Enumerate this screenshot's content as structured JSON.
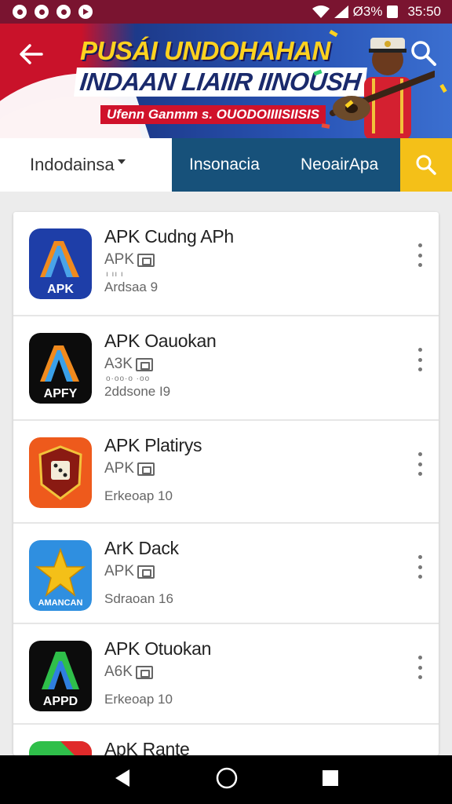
{
  "status_bar": {
    "signal_text": "Ø3%",
    "time": "35:50",
    "left_icons": [
      "notification-icon",
      "hanger-icon",
      "shield-icon",
      "play-icon"
    ],
    "right_icons": [
      "wifi-icon",
      "signal-icon",
      "battery-icon"
    ]
  },
  "banner": {
    "line1": "PUSÁI UNDOHAHAN",
    "line2": "INDAAN LIAIIR IINOUSH",
    "line3": "Ufenn Ganmm s. OUODOIIIISIISIS",
    "colors": {
      "red": "#c9122a",
      "blue": "#1d3a8a",
      "yellow": "#ffd21f"
    }
  },
  "tabs": {
    "country_select": "Indodainsa",
    "tab1": "Insonacia",
    "tab2": "NeoairApa"
  },
  "apps": [
    {
      "name": "APK Cudng APh",
      "sub": "APK",
      "dots": "ı  ıı  ı",
      "version": "Ardsaa 9",
      "icon_label": "APK",
      "icon": "apk-a-icon"
    },
    {
      "name": "APK Oauokan",
      "sub": "A3K",
      "dots": "o·oo·o ·oo",
      "version": "2ddsone I9",
      "icon_label": "APFY",
      "icon": "apk-a-dark-icon"
    },
    {
      "name": "APK Platirys",
      "sub": "APK",
      "dots": "",
      "version": "Erkeoap 10",
      "icon_label": "",
      "icon": "shield-dice-icon"
    },
    {
      "name": "ArK Dack",
      "sub": "APK",
      "dots": "",
      "version": "Sdraoan 16",
      "icon_label": "AMANCAN",
      "icon": "star-icon"
    },
    {
      "name": "APK Otuokan",
      "sub": "A6K",
      "dots": "",
      "version": "Erkeoap 10",
      "icon_label": "APPD",
      "icon": "apk-green-a-icon"
    },
    {
      "name": "ApK Rante",
      "sub": "",
      "dots": "",
      "version": "",
      "icon_label": "",
      "icon": "flag-icon"
    }
  ],
  "navbar": {
    "icons": [
      "back-icon",
      "home-icon",
      "recents-icon"
    ]
  }
}
